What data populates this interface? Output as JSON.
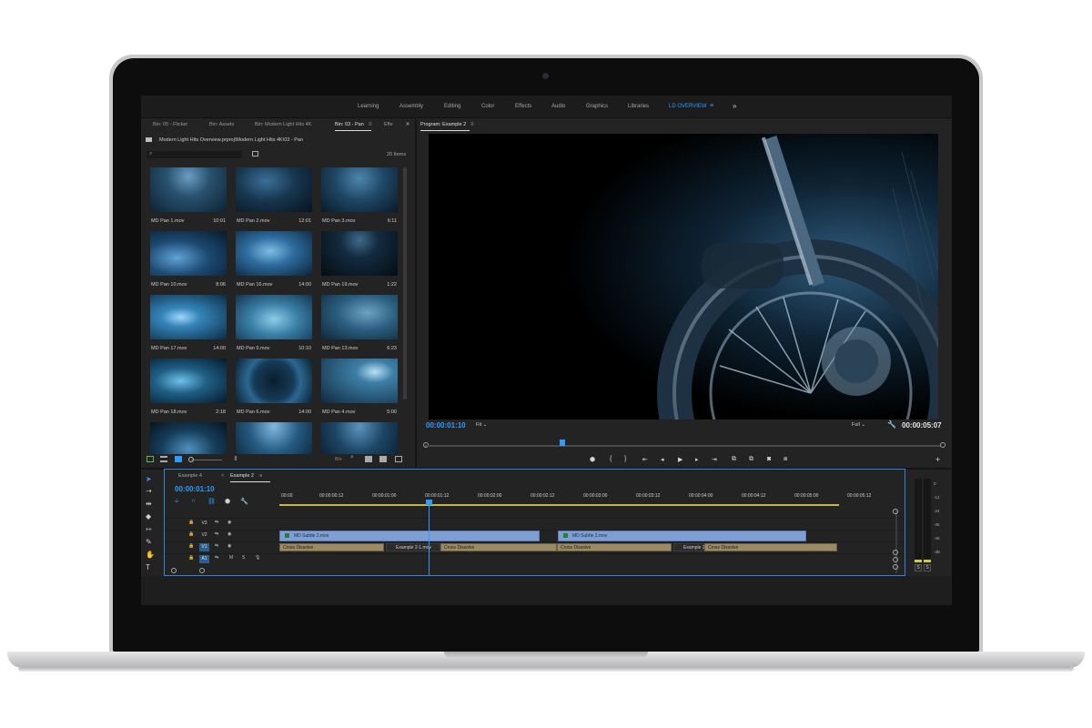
{
  "workspaces": {
    "items": [
      "Learning",
      "Assembly",
      "Editing",
      "Color",
      "Effects",
      "Audio",
      "Graphics",
      "Libraries",
      "LD OVERVIEW"
    ],
    "active": "LD OVERVIEW",
    "menu_icon": "hamburger-icon",
    "more_icon": "double-chevron-right-icon"
  },
  "project": {
    "tabs": [
      "Bin: 05 - Flicker",
      "Bin: Assets",
      "Bin: Modern Light Hits 4K",
      "Bin: 03 - Pan",
      "Effe"
    ],
    "active_tab": "Bin: 03 - Pan",
    "path": "Modern Light Hits Overview.prproj\\Modern Light Hits 4K\\03 - Pan",
    "search_placeholder": "",
    "items_count": "20 Items",
    "clips": [
      {
        "name": "MD Pan 1.mov",
        "duration": "10:01"
      },
      {
        "name": "MD Pan 2.mov",
        "duration": "12:01"
      },
      {
        "name": "MD Pan 3.mov",
        "duration": "6:11"
      },
      {
        "name": "MD Pan 10.mov",
        "duration": "8:06"
      },
      {
        "name": "MD Pan 16.mov",
        "duration": "14:00"
      },
      {
        "name": "MD Pan 19.mov",
        "duration": "1:22"
      },
      {
        "name": "MD Pan 17.mov",
        "duration": "14:00"
      },
      {
        "name": "MD Pan 9.mov",
        "duration": "10:10"
      },
      {
        "name": "MD Pan 13.mov",
        "duration": "6:23"
      },
      {
        "name": "MD Pan 18.mov",
        "duration": "2:18"
      },
      {
        "name": "MD Pan 6.mov",
        "duration": "14:00"
      },
      {
        "name": "MD Pan 4.mov",
        "duration": "5:00"
      }
    ],
    "footer_bin_label": "Bin:"
  },
  "program": {
    "title": "Program: Example 2",
    "timecode_current": "00:00:01:10",
    "zoom": "Fit",
    "resolution": "Full",
    "timecode_duration": "00:00:05:07",
    "transport_icons": [
      "marker-icon",
      "mark-in-icon",
      "mark-out-icon",
      "go-to-in-icon",
      "step-back-icon",
      "play-icon",
      "step-forward-icon",
      "go-to-out-icon",
      "lift-icon",
      "extract-icon",
      "export-frame-icon",
      "comparison-view-icon"
    ],
    "add_icon": "plus-icon",
    "playhead_fraction": 0.27
  },
  "timeline": {
    "tabs": [
      "Example 4",
      "Example 2"
    ],
    "active_tab": "Example 2",
    "timecode": "00:00:01:10",
    "ruler": [
      "00:00",
      "00:00:00:12",
      "00:00:01:00",
      "00:00:01:12",
      "00:00:02:00",
      "00:00:02:12",
      "00:00:03:00",
      "00:00:03:12",
      "00:00:04:00",
      "00:00:04:12",
      "00:00:05:00",
      "00:00:05:12"
    ],
    "tracks": {
      "video": [
        "V3",
        "V2",
        "V1"
      ],
      "audio": [
        "A1"
      ],
      "source_v": "V1",
      "source_a": "A1",
      "audio_controls": [
        "M",
        "S"
      ]
    },
    "clips": {
      "v2_a": "MD Subtle 2.mov",
      "v2_b": "MD Subtle 2.mov",
      "v1_a": "Cross Dissolve",
      "v1_b": "Example 2-1.mov",
      "v1_c": "Cross Dissolve",
      "v1_d": "Cross Dissolve",
      "v1_e": "Example 2-1",
      "v1_f": "Cross Dissolve"
    }
  },
  "meters": {
    "scale": [
      "0",
      "-12",
      "-24",
      "-36",
      "-48",
      "-dB"
    ],
    "solo": [
      "S",
      "S"
    ]
  },
  "tools": [
    "selection-tool-icon",
    "track-select-icon",
    "ripple-edit-icon",
    "razor-icon",
    "slip-icon",
    "pen-icon",
    "hand-icon",
    "type-icon"
  ],
  "colors": {
    "accent": "#2f9bff",
    "video_clip": "#7f9ed4",
    "audio_clip": "#9b8a63",
    "panel": "#232323"
  }
}
